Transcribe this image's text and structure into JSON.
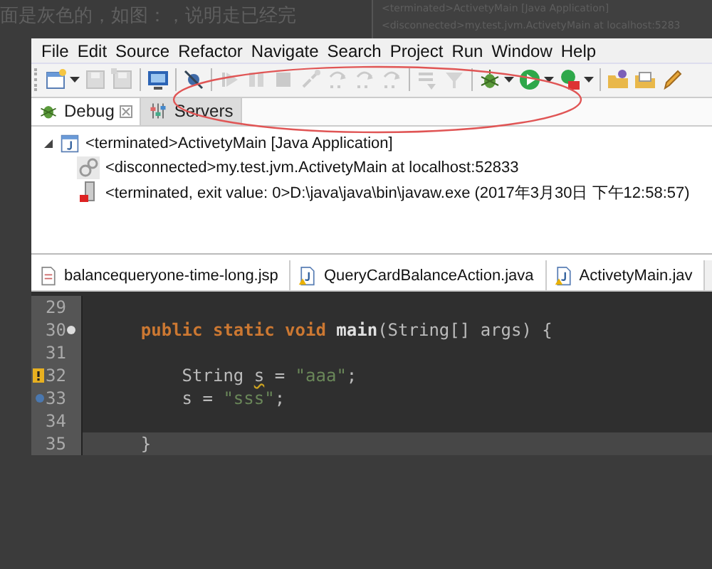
{
  "article_text": "面是灰色的，如图：，说明走已经完",
  "thumbnail_lines": [
    "<terminated>ActivetyMain [Java Application]",
    "<disconnected>my.test.jvm.ActivetyMain at localhost:5283"
  ],
  "menu": [
    "File",
    "Edit",
    "Source",
    "Refactor",
    "Navigate",
    "Search",
    "Project",
    "Run",
    "Window",
    "Help"
  ],
  "toolbar": [
    {
      "kind": "new",
      "disabled": false,
      "dropdown": true
    },
    {
      "kind": "save",
      "disabled": true,
      "dropdown": false
    },
    {
      "kind": "save-all",
      "disabled": true,
      "dropdown": false
    },
    {
      "kind": "sep"
    },
    {
      "kind": "monitor",
      "disabled": false,
      "dropdown": false
    },
    {
      "kind": "sep"
    },
    {
      "kind": "skip",
      "disabled": false,
      "dropdown": false
    },
    {
      "kind": "sep"
    },
    {
      "kind": "resume",
      "disabled": true,
      "dropdown": false
    },
    {
      "kind": "suspend",
      "disabled": true,
      "dropdown": false
    },
    {
      "kind": "terminate",
      "disabled": true,
      "dropdown": false
    },
    {
      "kind": "disconnect",
      "disabled": true,
      "dropdown": false
    },
    {
      "kind": "step-into",
      "disabled": true,
      "dropdown": false
    },
    {
      "kind": "step-over",
      "disabled": true,
      "dropdown": false
    },
    {
      "kind": "step-return",
      "disabled": true,
      "dropdown": false
    },
    {
      "kind": "sep"
    },
    {
      "kind": "drop-frame",
      "disabled": true,
      "dropdown": false
    },
    {
      "kind": "step-filter",
      "disabled": true,
      "dropdown": false
    },
    {
      "kind": "sep"
    },
    {
      "kind": "debug",
      "disabled": false,
      "dropdown": true
    },
    {
      "kind": "run",
      "disabled": false,
      "dropdown": true
    },
    {
      "kind": "external",
      "disabled": false,
      "dropdown": true
    },
    {
      "kind": "sep"
    },
    {
      "kind": "folder-new",
      "disabled": false,
      "dropdown": false
    },
    {
      "kind": "folder",
      "disabled": false,
      "dropdown": false
    },
    {
      "kind": "pencil",
      "disabled": false,
      "dropdown": false
    }
  ],
  "view_tabs": [
    {
      "label": "Debug",
      "selected": true,
      "closable": true
    },
    {
      "label": "Servers",
      "selected": false,
      "closable": false
    }
  ],
  "debug_tree": [
    {
      "label": "<terminated>ActivetyMain [Java Application]",
      "expanded": true,
      "children": [
        {
          "label": "<disconnected>my.test.jvm.ActivetyMain at localhost:52833"
        },
        {
          "label": "<terminated, exit value: 0>D:\\java\\java\\bin\\javaw.exe (2017年3月30日 下午12:58:57)"
        }
      ]
    }
  ],
  "editor_tabs": [
    "balancequeryone-time-long.jsp",
    "QueryCardBalanceAction.java",
    "ActivetyMain.jav"
  ],
  "code_lines": [
    {
      "number": "29",
      "kind": "plain",
      "current": false
    },
    {
      "number": "30",
      "kind": "fold",
      "current": false,
      "tokens": [
        {
          "kind": "keyword",
          "text": "    public static void "
        },
        {
          "kind": "method",
          "text": "main"
        },
        {
          "kind": "plain",
          "text": "(String[] args) {"
        }
      ]
    },
    {
      "number": "31",
      "kind": "plain",
      "current": false
    },
    {
      "number": "32",
      "kind": "warning",
      "current": false,
      "tokens": [
        {
          "kind": "plain",
          "text": "        String "
        },
        {
          "kind": "warn",
          "text": "s"
        },
        {
          "kind": "plain",
          "text": " = "
        },
        {
          "kind": "string",
          "text": "\"aaa\""
        },
        {
          "kind": "plain",
          "text": ";"
        }
      ]
    },
    {
      "number": "33",
      "kind": "breakpoint",
      "current": false,
      "tokens": [
        {
          "kind": "plain",
          "text": "        s = "
        },
        {
          "kind": "string",
          "text": "\"sss\""
        },
        {
          "kind": "plain",
          "text": ";"
        }
      ]
    },
    {
      "number": "34",
      "kind": "plain",
      "current": false
    },
    {
      "number": "35",
      "kind": "plain",
      "current": true,
      "tokens": [
        {
          "kind": "plain",
          "text": "    }"
        }
      ]
    }
  ]
}
